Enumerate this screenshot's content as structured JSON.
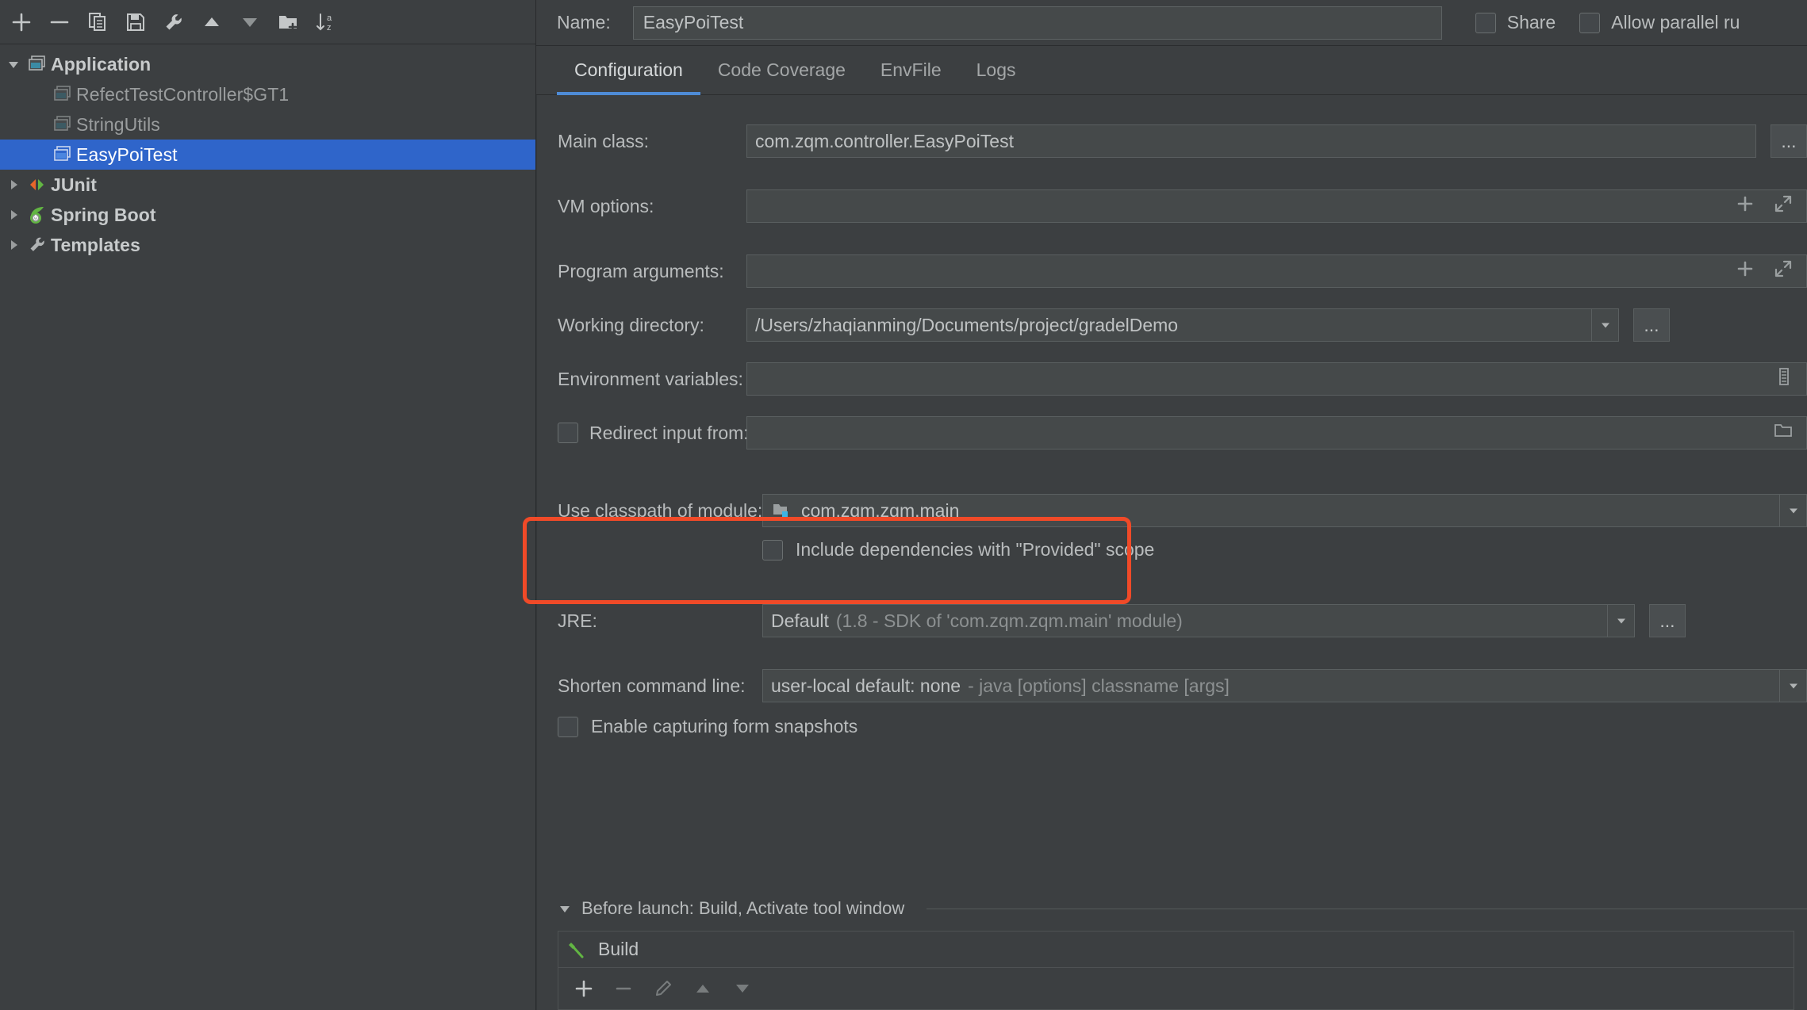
{
  "toolbar": {
    "buttons": [
      {
        "name": "add-icon",
        "title": "Add New Configuration"
      },
      {
        "name": "remove-icon",
        "title": "Remove Configuration"
      },
      {
        "name": "copy-icon",
        "title": "Copy Configuration"
      },
      {
        "name": "save-icon",
        "title": "Save Configuration"
      },
      {
        "name": "wrench-icon",
        "title": "Edit Defaults"
      },
      {
        "name": "move-up-icon",
        "title": "Move Up"
      },
      {
        "name": "move-down-icon",
        "title": "Move Down"
      },
      {
        "name": "new-folder-icon",
        "title": "Create New Folder"
      },
      {
        "name": "sort-alpha-icon",
        "title": "Sort Configurations"
      }
    ]
  },
  "tree": {
    "items": [
      {
        "label": "Application",
        "icon": "application-icon",
        "depth": 0,
        "expanded": true,
        "bold": true,
        "selected": false
      },
      {
        "label": "RefectTestController$GT1",
        "icon": "run-config-icon",
        "depth": 1,
        "bold": false,
        "selected": false
      },
      {
        "label": "StringUtils",
        "icon": "run-config-icon",
        "depth": 1,
        "bold": false,
        "selected": false
      },
      {
        "label": "EasyPoiTest",
        "icon": "run-config-icon",
        "depth": 1,
        "bold": false,
        "selected": true
      },
      {
        "label": "JUnit",
        "icon": "junit-icon",
        "depth": 0,
        "expanded": false,
        "bold": true,
        "selected": false
      },
      {
        "label": "Spring Boot",
        "icon": "spring-boot-icon",
        "depth": 0,
        "expanded": false,
        "bold": true,
        "selected": false
      },
      {
        "label": "Templates",
        "icon": "templates-wrench-icon",
        "depth": 0,
        "expanded": false,
        "bold": true,
        "selected": false
      }
    ]
  },
  "header": {
    "name_label": "Name:",
    "name_value": "EasyPoiTest",
    "name_placeholder": "",
    "share_label": "Share",
    "allow_parallel_label": "Allow parallel ru"
  },
  "tabs": [
    {
      "label": "Configuration",
      "active": true
    },
    {
      "label": "Code Coverage",
      "active": false
    },
    {
      "label": "EnvFile",
      "active": false
    },
    {
      "label": "Logs",
      "active": false
    }
  ],
  "form": {
    "main_class": {
      "label": "Main class:",
      "value": "com.zqm.controller.EasyPoiTest"
    },
    "vm_options": {
      "label": "VM options:",
      "value": "",
      "placeholder": ""
    },
    "program_arguments": {
      "label": "Program arguments:",
      "value": "",
      "placeholder": ""
    },
    "working_directory": {
      "label": "Working directory:",
      "value": "/Users/zhaqianming/Documents/project/gradelDemo"
    },
    "environment_variables": {
      "label": "Environment variables:",
      "value": "",
      "placeholder": ""
    },
    "redirect_input": {
      "label": "Redirect input from:",
      "value": "",
      "checked": false
    },
    "use_classpath": {
      "label": "Use classpath of module:",
      "value": "com.zqm.zqm.main"
    },
    "include_dependencies": {
      "label": "Include dependencies with \"Provided\" scope",
      "checked": false
    },
    "jre": {
      "label": "JRE:",
      "value_primary": "Default",
      "value_secondary": "(1.8 - SDK of 'com.zqm.zqm.main' module)"
    },
    "shorten_command_line": {
      "label": "Shorten command line:",
      "value_primary": "user-local default: none",
      "value_secondary": "- java [options] classname [args]"
    },
    "enable_capturing": {
      "label": "Enable capturing form snapshots",
      "checked": false
    },
    "dots_label": "..."
  },
  "before_launch": {
    "title": "Before launch: Build, Activate tool window",
    "items": [
      {
        "label": "Build",
        "icon": "build-hammer-icon"
      }
    ],
    "tools": [
      {
        "name": "add-task-icon"
      },
      {
        "name": "remove-task-icon"
      },
      {
        "name": "edit-task-icon"
      },
      {
        "name": "move-task-up-icon"
      },
      {
        "name": "move-task-down-icon"
      }
    ]
  },
  "colors": {
    "selection_blue": "#2f65ca",
    "accent_tab": "#4e8bd6",
    "annotation_red": "#f04a28",
    "panel_bg": "#3c3f41",
    "field_bg": "#45494a"
  },
  "annotation": {
    "shape": "rounded-rectangle",
    "color": "#f04a28",
    "target": "use-classpath-of-module-row"
  }
}
